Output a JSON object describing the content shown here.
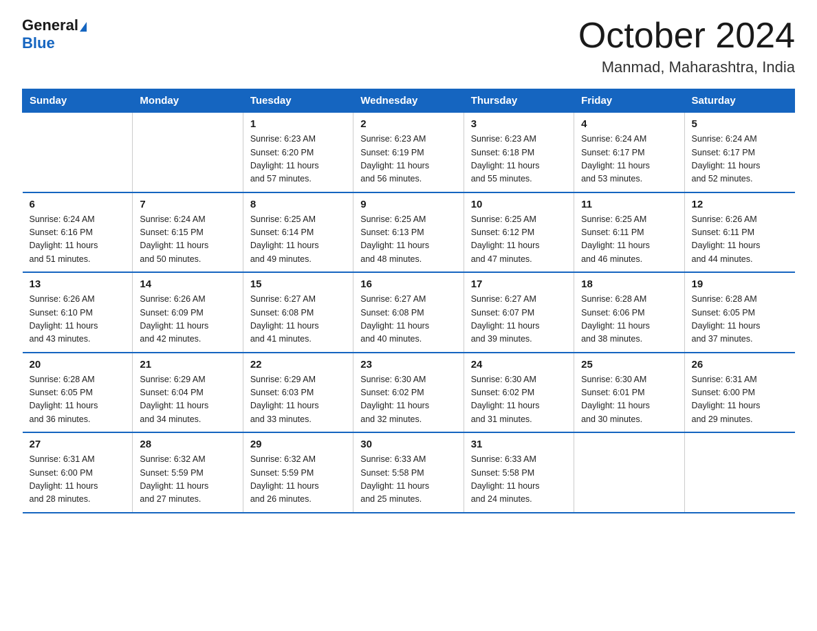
{
  "header": {
    "logo_general": "General",
    "logo_blue": "Blue",
    "month_title": "October 2024",
    "location": "Manmad, Maharashtra, India"
  },
  "days_of_week": [
    "Sunday",
    "Monday",
    "Tuesday",
    "Wednesday",
    "Thursday",
    "Friday",
    "Saturday"
  ],
  "weeks": [
    [
      {
        "day": "",
        "info": ""
      },
      {
        "day": "",
        "info": ""
      },
      {
        "day": "1",
        "info": "Sunrise: 6:23 AM\nSunset: 6:20 PM\nDaylight: 11 hours\nand 57 minutes."
      },
      {
        "day": "2",
        "info": "Sunrise: 6:23 AM\nSunset: 6:19 PM\nDaylight: 11 hours\nand 56 minutes."
      },
      {
        "day": "3",
        "info": "Sunrise: 6:23 AM\nSunset: 6:18 PM\nDaylight: 11 hours\nand 55 minutes."
      },
      {
        "day": "4",
        "info": "Sunrise: 6:24 AM\nSunset: 6:17 PM\nDaylight: 11 hours\nand 53 minutes."
      },
      {
        "day": "5",
        "info": "Sunrise: 6:24 AM\nSunset: 6:17 PM\nDaylight: 11 hours\nand 52 minutes."
      }
    ],
    [
      {
        "day": "6",
        "info": "Sunrise: 6:24 AM\nSunset: 6:16 PM\nDaylight: 11 hours\nand 51 minutes."
      },
      {
        "day": "7",
        "info": "Sunrise: 6:24 AM\nSunset: 6:15 PM\nDaylight: 11 hours\nand 50 minutes."
      },
      {
        "day": "8",
        "info": "Sunrise: 6:25 AM\nSunset: 6:14 PM\nDaylight: 11 hours\nand 49 minutes."
      },
      {
        "day": "9",
        "info": "Sunrise: 6:25 AM\nSunset: 6:13 PM\nDaylight: 11 hours\nand 48 minutes."
      },
      {
        "day": "10",
        "info": "Sunrise: 6:25 AM\nSunset: 6:12 PM\nDaylight: 11 hours\nand 47 minutes."
      },
      {
        "day": "11",
        "info": "Sunrise: 6:25 AM\nSunset: 6:11 PM\nDaylight: 11 hours\nand 46 minutes."
      },
      {
        "day": "12",
        "info": "Sunrise: 6:26 AM\nSunset: 6:11 PM\nDaylight: 11 hours\nand 44 minutes."
      }
    ],
    [
      {
        "day": "13",
        "info": "Sunrise: 6:26 AM\nSunset: 6:10 PM\nDaylight: 11 hours\nand 43 minutes."
      },
      {
        "day": "14",
        "info": "Sunrise: 6:26 AM\nSunset: 6:09 PM\nDaylight: 11 hours\nand 42 minutes."
      },
      {
        "day": "15",
        "info": "Sunrise: 6:27 AM\nSunset: 6:08 PM\nDaylight: 11 hours\nand 41 minutes."
      },
      {
        "day": "16",
        "info": "Sunrise: 6:27 AM\nSunset: 6:08 PM\nDaylight: 11 hours\nand 40 minutes."
      },
      {
        "day": "17",
        "info": "Sunrise: 6:27 AM\nSunset: 6:07 PM\nDaylight: 11 hours\nand 39 minutes."
      },
      {
        "day": "18",
        "info": "Sunrise: 6:28 AM\nSunset: 6:06 PM\nDaylight: 11 hours\nand 38 minutes."
      },
      {
        "day": "19",
        "info": "Sunrise: 6:28 AM\nSunset: 6:05 PM\nDaylight: 11 hours\nand 37 minutes."
      }
    ],
    [
      {
        "day": "20",
        "info": "Sunrise: 6:28 AM\nSunset: 6:05 PM\nDaylight: 11 hours\nand 36 minutes."
      },
      {
        "day": "21",
        "info": "Sunrise: 6:29 AM\nSunset: 6:04 PM\nDaylight: 11 hours\nand 34 minutes."
      },
      {
        "day": "22",
        "info": "Sunrise: 6:29 AM\nSunset: 6:03 PM\nDaylight: 11 hours\nand 33 minutes."
      },
      {
        "day": "23",
        "info": "Sunrise: 6:30 AM\nSunset: 6:02 PM\nDaylight: 11 hours\nand 32 minutes."
      },
      {
        "day": "24",
        "info": "Sunrise: 6:30 AM\nSunset: 6:02 PM\nDaylight: 11 hours\nand 31 minutes."
      },
      {
        "day": "25",
        "info": "Sunrise: 6:30 AM\nSunset: 6:01 PM\nDaylight: 11 hours\nand 30 minutes."
      },
      {
        "day": "26",
        "info": "Sunrise: 6:31 AM\nSunset: 6:00 PM\nDaylight: 11 hours\nand 29 minutes."
      }
    ],
    [
      {
        "day": "27",
        "info": "Sunrise: 6:31 AM\nSunset: 6:00 PM\nDaylight: 11 hours\nand 28 minutes."
      },
      {
        "day": "28",
        "info": "Sunrise: 6:32 AM\nSunset: 5:59 PM\nDaylight: 11 hours\nand 27 minutes."
      },
      {
        "day": "29",
        "info": "Sunrise: 6:32 AM\nSunset: 5:59 PM\nDaylight: 11 hours\nand 26 minutes."
      },
      {
        "day": "30",
        "info": "Sunrise: 6:33 AM\nSunset: 5:58 PM\nDaylight: 11 hours\nand 25 minutes."
      },
      {
        "day": "31",
        "info": "Sunrise: 6:33 AM\nSunset: 5:58 PM\nDaylight: 11 hours\nand 24 minutes."
      },
      {
        "day": "",
        "info": ""
      },
      {
        "day": "",
        "info": ""
      }
    ]
  ]
}
